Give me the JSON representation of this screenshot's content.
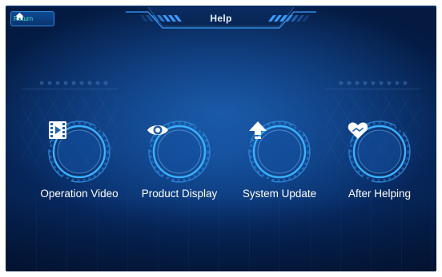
{
  "header": {
    "title": "Help"
  },
  "back_button": {
    "label": "Return",
    "icon": "home-icon"
  },
  "menu": [
    {
      "label": "Operation Video",
      "icon": "film-play-icon"
    },
    {
      "label": "Product Display",
      "icon": "eye-icon"
    },
    {
      "label": "System Update",
      "icon": "upload-arrow-icon"
    },
    {
      "label": "After Helping",
      "icon": "heart-hands-icon"
    }
  ],
  "colors": {
    "background": "#072a63",
    "accent": "#3aa0ff",
    "return_text": "#4ee0c8"
  }
}
